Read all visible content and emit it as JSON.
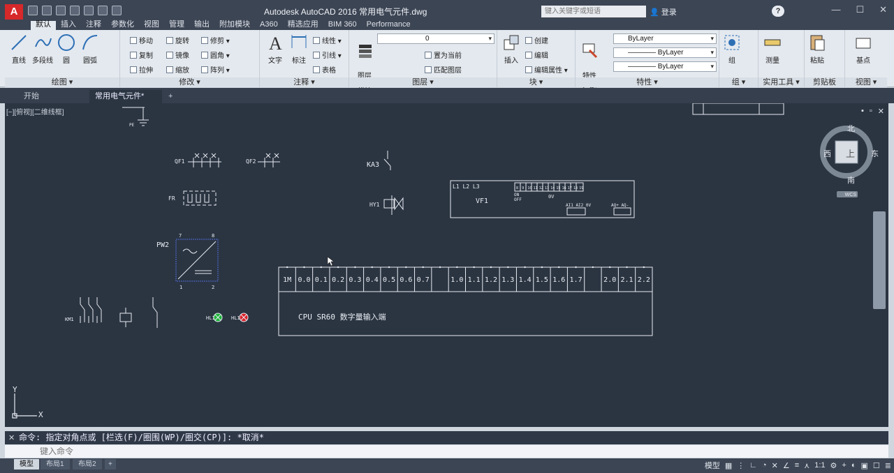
{
  "titlebar": {
    "logo": "A",
    "app_title": "Autodesk AutoCAD 2016    常用电气元件.dwg",
    "search_placeholder": "键入关键字或短语",
    "login": "登录",
    "help": "?",
    "window": [
      "—",
      "☐",
      "✕"
    ]
  },
  "tabs": [
    "默认",
    "插入",
    "注释",
    "参数化",
    "视图",
    "管理",
    "输出",
    "附加模块",
    "A360",
    "精选应用",
    "BIM 360",
    "Performance"
  ],
  "ribbon": {
    "draw": {
      "title": "绘图 ▾",
      "buttons": [
        "直线",
        "多段线",
        "圆",
        "圆弧"
      ]
    },
    "modify": {
      "title": "修改 ▾",
      "items": [
        "移动",
        "旋转",
        "修剪 ▾",
        "复制",
        "镜像",
        "圆角 ▾",
        "拉伸",
        "缩放",
        "阵列 ▾"
      ]
    },
    "annotation": {
      "title": "注释 ▾",
      "buttons": [
        "文字",
        "标注"
      ],
      "items": [
        "线性 ▾",
        "引线 ▾",
        "表格"
      ]
    },
    "layers": {
      "title": "图层 ▾",
      "button": "图层\n特性",
      "layer": "0",
      "items": [
        "置为当前",
        "匹配图层"
      ]
    },
    "block": {
      "title": "块 ▾",
      "button": "插入",
      "items": [
        "创建",
        "编辑",
        "编辑属性 ▾"
      ]
    },
    "properties": {
      "title": "特性 ▾",
      "button": "特性\n匹配",
      "combos": [
        "ByLayer",
        "———— ByLayer",
        "———— ByLayer"
      ]
    },
    "groups": {
      "title": "组 ▾",
      "button": "组"
    },
    "utilities": {
      "title": "实用工具 ▾",
      "button": "测量"
    },
    "clipboard": {
      "title": "剪贴板",
      "button": "粘贴"
    },
    "view": {
      "title": "视图 ▾",
      "button": "基点"
    }
  },
  "filetabs": {
    "start": "开始",
    "current": "常用电气元件*",
    "add": "+"
  },
  "viewport": {
    "label": "[−][俯视][二维线框]"
  },
  "drawing": {
    "pe": "PE",
    "qf1": "QF1",
    "qf2": "QF2",
    "ka3": "KA3",
    "fr": "FR",
    "hy1": "HY1",
    "pw2": "PW2",
    "pw2_pins": [
      "7",
      "8",
      "1",
      "2"
    ],
    "km1": "KM1",
    "hl1a": "HL1",
    "hl1b": "HL1",
    "vf1": {
      "label": "VF1",
      "lines": "L1 L2 L3",
      "pins": [
        "8",
        "9",
        "10",
        "11",
        "12",
        "13",
        "14",
        "15",
        "16",
        "17",
        "18",
        "19"
      ],
      "on": "ON",
      "off": "OFF",
      "ov": "0V",
      "ai": "AI1 AI2 0V",
      "ao": "AQ+ AQ-"
    },
    "plc": {
      "title": "CPU SR60  数字量输入端",
      "terminals": [
        "1M",
        "0.0",
        "0.1",
        "0.2",
        "0.3",
        "0.4",
        "0.5",
        "0.6",
        "0.7",
        "",
        "1.0",
        "1.1",
        "1.2",
        "1.3",
        "1.4",
        "1.5",
        "1.6",
        "1.7",
        "",
        "2.0",
        "2.1",
        "2.2"
      ]
    },
    "ucs": {
      "x": "X",
      "y": "Y"
    }
  },
  "viewcube": {
    "north": "北",
    "south": "南",
    "east": "东",
    "west": "西",
    "top": "上",
    "wcs": "WCS"
  },
  "command": {
    "history": "命令: 指定对角点或 [栏选(F)/圈围(WP)/圈交(CP)]: *取消*",
    "placeholder": "键入命令"
  },
  "status": {
    "layouts": [
      "模型",
      "布局1",
      "布局2"
    ],
    "model": "模型",
    "scale": "1:1"
  }
}
